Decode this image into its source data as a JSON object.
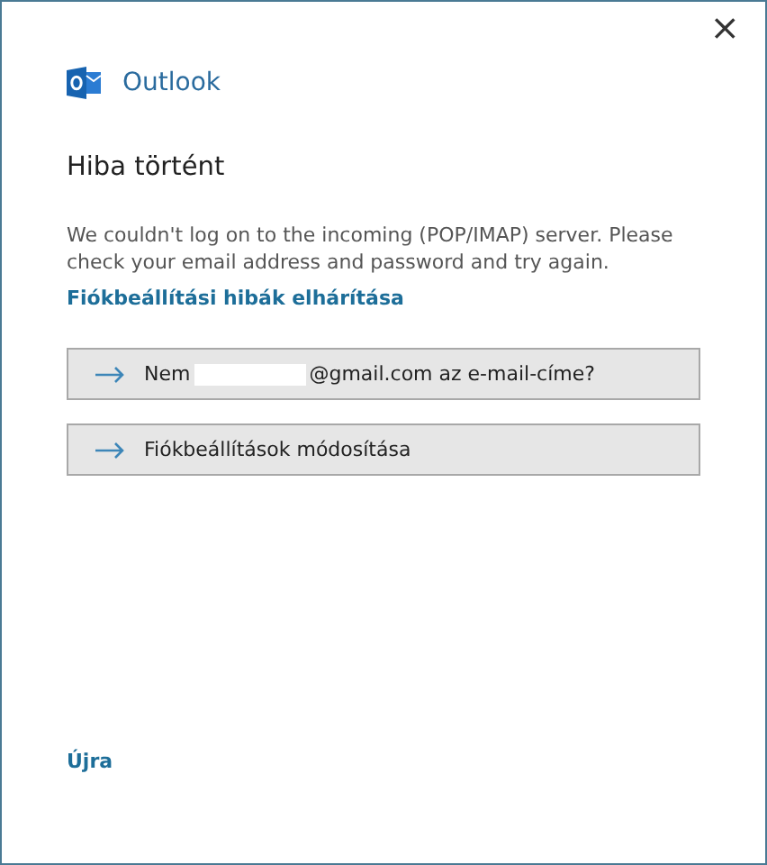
{
  "window": {
    "close": "×"
  },
  "brand": {
    "name": "Outlook"
  },
  "title": "Hiba történt",
  "message": "We couldn't log on to the incoming (POP/IMAP) server. Please check your email address and password and try again.",
  "help_link": "Fiókbeállítási hibák elhárítása",
  "actions": [
    {
      "kind": "redacted",
      "prefix": "Nem",
      "suffix": "@gmail.com az e-mail-címe?"
    },
    {
      "kind": "plain",
      "label": "Fiókbeállítások módosítása"
    }
  ],
  "retry_link": "Újra"
}
